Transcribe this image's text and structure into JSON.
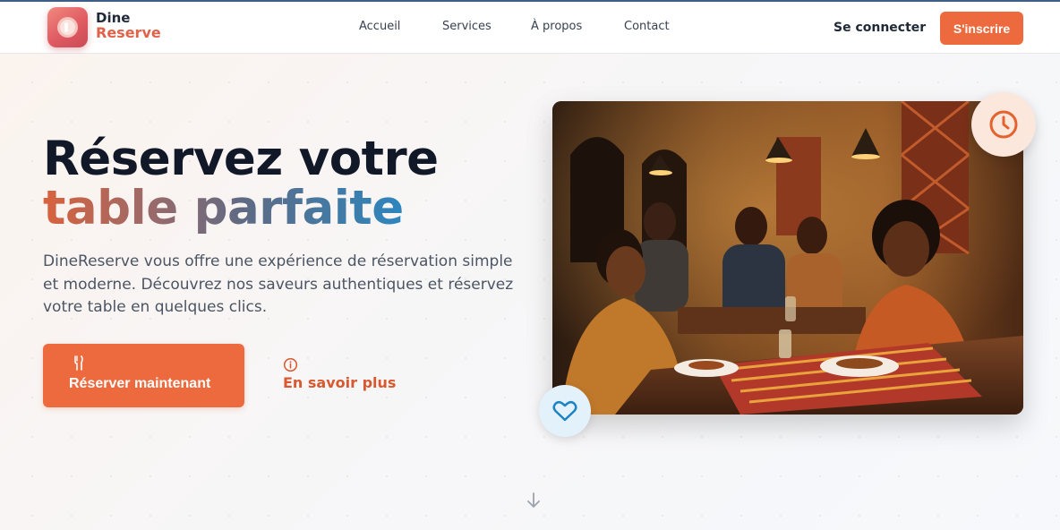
{
  "brand": {
    "name_line1": "Dine",
    "name_line2": "Reserve",
    "logo_icon": "plate-icon"
  },
  "nav": {
    "links": [
      "Accueil",
      "Services",
      "À propos",
      "Contact"
    ],
    "login_label": "Se connecter",
    "signup_label": "S'inscrire"
  },
  "hero": {
    "title_line1": "Réservez votre",
    "title_line2": "table parfaite",
    "description": "DineReserve vous offre une expérience de réservation simple et moderne. Découvrez nos saveurs authentiques et réservez votre table en quelques clics.",
    "primary_cta_label": "Réserver maintenant",
    "primary_cta_icon": "utensils-icon",
    "secondary_cta_label": "En savoir plus",
    "secondary_cta_icon": "info-icon",
    "image_icon_top": "clock-icon",
    "image_icon_bottom": "heart-icon",
    "scroll_icon": "arrow-down-icon"
  },
  "colors": {
    "accent": "#ec6a3e",
    "heading": "#111827",
    "gradient_start": "#d9623d",
    "gradient_end": "#2d86bf"
  }
}
